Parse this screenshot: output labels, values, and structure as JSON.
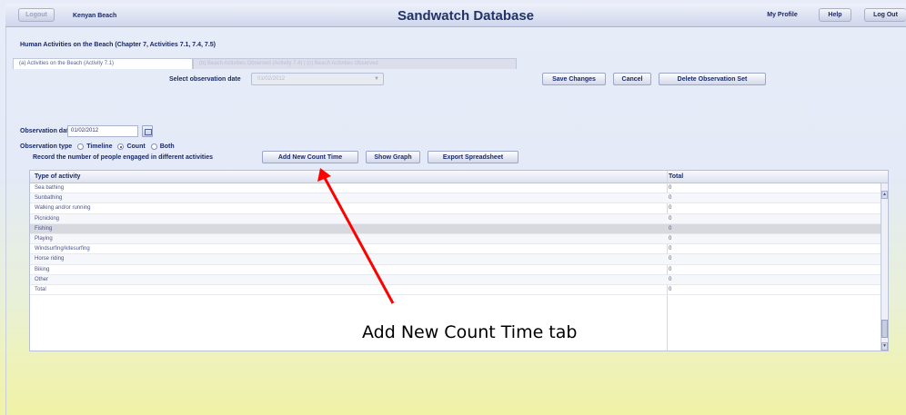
{
  "topbar": {
    "left_button": "Logout",
    "location": "Kenyan Beach",
    "title": "Sandwatch Database",
    "my_profile": "My Profile",
    "help": "Help",
    "logout": "Log Out"
  },
  "breadcrumb": "Human Activities on the Beach (Chapter 7, Activities 7.1, 7.4, 7.5)",
  "tabs": [
    {
      "label": "(a) Activities on the Beach (Activity 7.1)"
    },
    {
      "label": "(b) Beach Activities Observed (Activity 7.4) | (c) Beach Activities Observed"
    }
  ],
  "select_observation": {
    "label": "Select observation date",
    "placeholder": "01/02/2012"
  },
  "actions": {
    "save": "Save Changes",
    "cancel": "Cancel",
    "delete": "Delete Observation Set"
  },
  "observation": {
    "date_label": "Observation date",
    "date_value": "01/02/2012",
    "type_label": "Observation type",
    "options": [
      "Timeline",
      "Count",
      "Both"
    ],
    "selected": "Count"
  },
  "record": {
    "label": "Record the number of people engaged in different activities",
    "add_count_time": "Add New Count Time",
    "show_graph": "Show Graph",
    "export": "Export Spreadsheet"
  },
  "table": {
    "columns": [
      "Type of activity",
      "Total"
    ],
    "rows": [
      {
        "activity": "Sea bathing",
        "total": "0"
      },
      {
        "activity": "Sunbathing",
        "total": "0"
      },
      {
        "activity": "Walking and/or running",
        "total": "0"
      },
      {
        "activity": "Picnicking",
        "total": "0"
      },
      {
        "activity": "Fishing",
        "total": "0"
      },
      {
        "activity": "Playing",
        "total": "0"
      },
      {
        "activity": "Windsurfing/kitesurfing",
        "total": "0"
      },
      {
        "activity": "Horse riding",
        "total": "0"
      },
      {
        "activity": "Biking",
        "total": "0"
      },
      {
        "activity": "Other",
        "total": "0"
      },
      {
        "activity": "Total",
        "total": "0"
      }
    ],
    "selected_row": 4
  },
  "annotation": {
    "text": "Add New Count Time tab",
    "arrow_color": "#ff0000"
  }
}
